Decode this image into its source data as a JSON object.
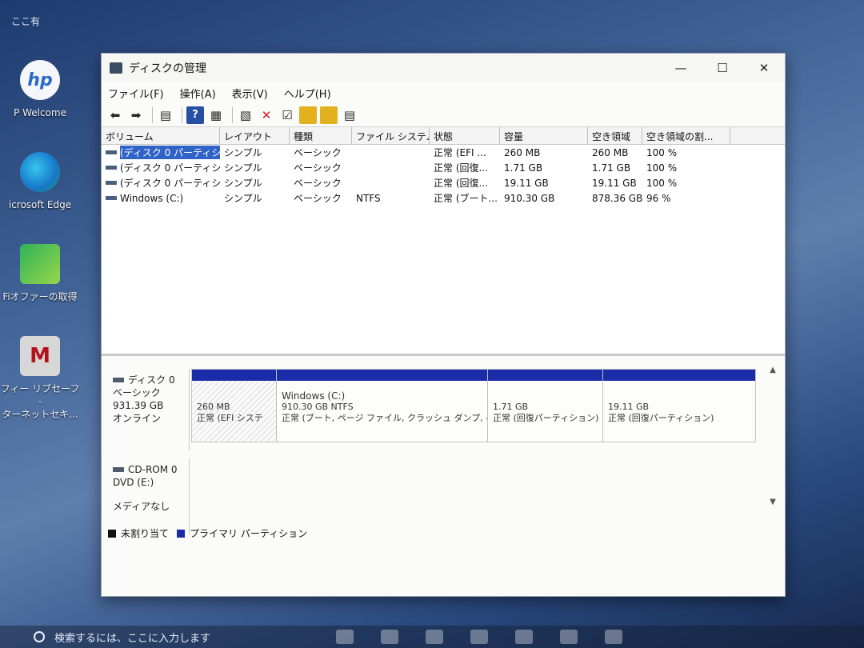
{
  "desktop": {
    "top_label": "ここ有",
    "icons": [
      {
        "label": "P Welcome",
        "glyph": "hp"
      },
      {
        "label": "icrosoft Edge",
        "glyph": ""
      },
      {
        "label": "Fiオファーの取得",
        "glyph": ""
      },
      {
        "label": "フィー リブセーフ -\nターネットセキ...",
        "glyph": "M"
      }
    ]
  },
  "window": {
    "title": "ディスクの管理",
    "controls": {
      "minimize": "—",
      "maximize": "☐",
      "close": "✕"
    },
    "menu": [
      "ファイル(F)",
      "操作(A)",
      "表示(V)",
      "ヘルプ(H)"
    ],
    "toolbar": {
      "help": "?",
      "delete": "✕"
    }
  },
  "volumes": {
    "columns": [
      "ボリューム",
      "レイアウト",
      "種類",
      "ファイル システム",
      "状態",
      "容量",
      "空き領域",
      "空き領域の割..."
    ],
    "rows": [
      {
        "volume": "(ディスク 0 パーティシ...",
        "layout": "シンプル",
        "type": "ベーシック",
        "fs": "",
        "status": "正常 (EFI ...",
        "capacity": "260 MB",
        "free": "260 MB",
        "pct": "100 %"
      },
      {
        "volume": "(ディスク 0 パーティシ...",
        "layout": "シンプル",
        "type": "ベーシック",
        "fs": "",
        "status": "正常 (回復...",
        "capacity": "1.71 GB",
        "free": "1.71 GB",
        "pct": "100 %"
      },
      {
        "volume": "(ディスク 0 パーティシ...",
        "layout": "シンプル",
        "type": "ベーシック",
        "fs": "",
        "status": "正常 (回復...",
        "capacity": "19.11 GB",
        "free": "19.11 GB",
        "pct": "100 %"
      },
      {
        "volume": "Windows (C:)",
        "layout": "シンプル",
        "type": "ベーシック",
        "fs": "NTFS",
        "status": "正常 (ブート...",
        "capacity": "910.30 GB",
        "free": "878.36 GB",
        "pct": "96 %"
      }
    ]
  },
  "disks": {
    "disk0": {
      "name": "ディスク 0",
      "type": "ベーシック",
      "size": "931.39 GB",
      "state": "オンライン",
      "partitions": [
        {
          "line1": "260 MB",
          "line2": "正常 (EFI システ"
        },
        {
          "name": "Windows (C:)",
          "line1": "910.30 GB NTFS",
          "line2": "正常 (ブート, ページ ファイル, クラッシュ ダンプ, ベ"
        },
        {
          "line1": "1.71 GB",
          "line2": "正常 (回復パーティション)"
        },
        {
          "line1": "19.11 GB",
          "line2": "正常 (回復パーティション)"
        }
      ]
    },
    "cdrom": {
      "name": "CD-ROM 0",
      "drive": "DVD (E:)",
      "media": "メディアなし"
    }
  },
  "legend": {
    "unallocated": "未割り当て",
    "primary": "プライマリ パーティション"
  },
  "taskbar": {
    "search_placeholder": "検索するには、ここに入力します"
  },
  "colors": {
    "partition_bar": "#1b2ca8",
    "selection": "#2f63c8"
  }
}
